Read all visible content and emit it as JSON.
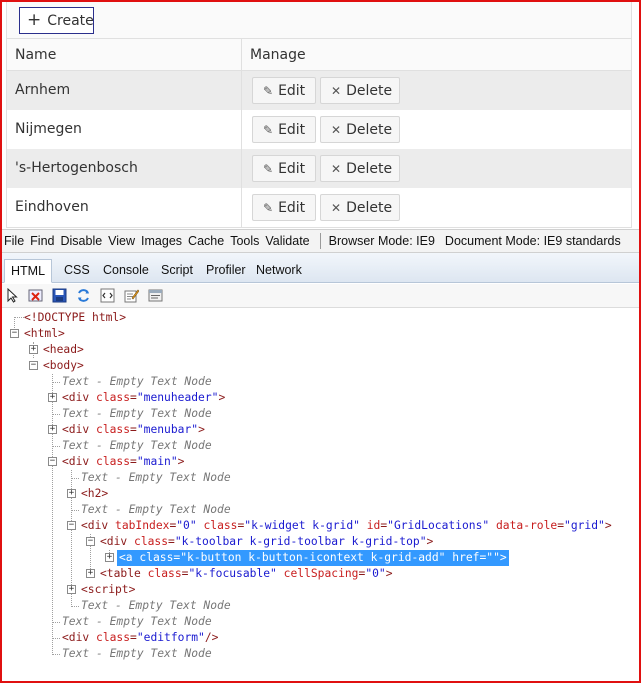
{
  "app": {
    "create_label": "Create",
    "grid": {
      "columns": [
        "Name",
        "Manage"
      ],
      "edit_label": "Edit",
      "delete_label": "Delete",
      "rows": [
        {
          "name": "Arnhem"
        },
        {
          "name": "Nijmegen"
        },
        {
          "name": "'s-Hertogenbosch"
        },
        {
          "name": "Eindhoven"
        }
      ]
    }
  },
  "devtools": {
    "menu": [
      "File",
      "Find",
      "Disable",
      "View",
      "Images",
      "Cache",
      "Tools",
      "Validate"
    ],
    "browser_mode": "Browser Mode:  IE9",
    "document_mode": "Document Mode:  IE9 standards",
    "tabs": [
      "HTML",
      "CSS",
      "Console",
      "Script",
      "Profiler",
      "Network"
    ],
    "active_tab": "HTML",
    "toolbar_icons": [
      "select-element-icon",
      "clear-icon",
      "save-icon",
      "refresh-icon",
      "word-wrap-icon",
      "edit-icon",
      "view-source-icon"
    ],
    "dom_tree": [
      {
        "open": "<!DOCTYPE ",
        "tag": "html",
        "close": ">"
      },
      {
        "tag_text": "<html>"
      },
      {
        "tag_text": "<head>"
      },
      {
        "tag_text": "<body>"
      },
      {
        "text": "Text - Empty Text Node"
      },
      {
        "tag": "<div ",
        "attr": "class",
        "eq": "=",
        "val": "\"menuheader\"",
        "end": ">"
      },
      {
        "text": "Text - Empty Text Node"
      },
      {
        "tag": "<div ",
        "attr": "class",
        "eq": "=",
        "val": "\"menubar\"",
        "end": ">"
      },
      {
        "text": "Text - Empty Text Node"
      },
      {
        "tag": "<div ",
        "attr": "class",
        "eq": "=",
        "val": "\"main\"",
        "end": ">"
      },
      {
        "text": "Text - Empty Text Node"
      },
      {
        "tag_text": "<h2>"
      },
      {
        "text": "Text - Empty Text Node"
      },
      {
        "tag": "<div ",
        "attrs": [
          [
            "tabIndex",
            "\"0\""
          ],
          [
            "class",
            "\"k-widget k-grid\""
          ],
          [
            "id",
            "\"GridLocations\""
          ],
          [
            "data-role",
            "\"grid\""
          ]
        ],
        "end": ">"
      },
      {
        "tag": "<div ",
        "attr": "class",
        "eq": "=",
        "val": "\"k-toolbar k-grid-toolbar k-grid-top\"",
        "end": ">"
      },
      {
        "selected_text": "<a class=\"k-button k-button-icontext k-grid-add\" href=\"\">"
      },
      {
        "tag": "<table ",
        "attrs": [
          [
            "class",
            "\"k-focusable\""
          ],
          [
            "cellSpacing",
            "\"0\""
          ]
        ],
        "end": ">"
      },
      {
        "tag_text": "<script>"
      },
      {
        "text": "Text - Empty Text Node"
      },
      {
        "text": "Text - Empty Text Node"
      },
      {
        "tag": "<div ",
        "attr": "class",
        "eq": "=",
        "val": "\"editform\"",
        "end": "/>"
      },
      {
        "text": "Text - Empty Text Node"
      }
    ]
  }
}
